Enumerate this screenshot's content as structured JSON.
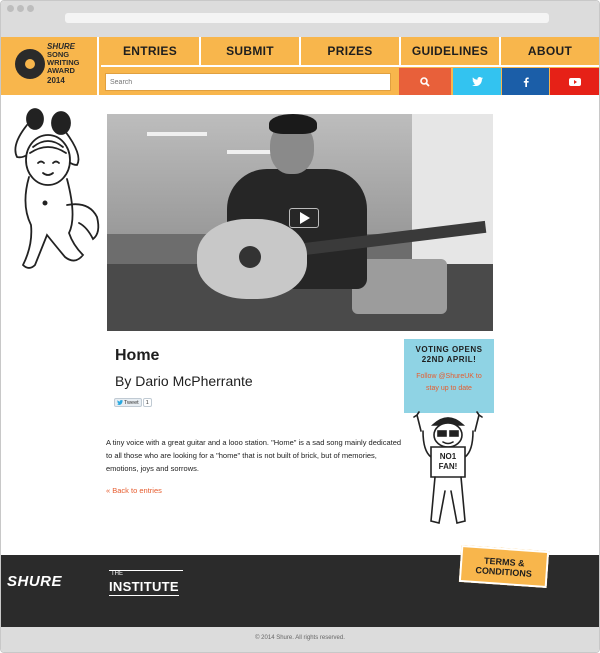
{
  "brand": {
    "brand_name": "SHURE",
    "line1": "SONG",
    "line2": "WRITING",
    "line3": "AWARD",
    "year": "2014"
  },
  "nav": {
    "items": [
      {
        "label": "ENTRIES"
      },
      {
        "label": "SUBMIT"
      },
      {
        "label": "PRIZES"
      },
      {
        "label": "GUIDELINES"
      },
      {
        "label": "ABOUT"
      }
    ]
  },
  "search": {
    "placeholder": "Search"
  },
  "icons": {
    "search": "magnifier-icon",
    "twitter": "twitter-bird-icon",
    "facebook": "facebook-f-icon",
    "youtube": "youtube-play-icon"
  },
  "colors": {
    "accent": "#f8b64c",
    "search_btn": "#e8603a",
    "twitter": "#33c3f0",
    "facebook": "#1b5ea8",
    "youtube": "#e62117",
    "vote_box": "#8fd3e4",
    "link": "#e65c2e"
  },
  "video": {
    "play_icon": "play-icon"
  },
  "entry": {
    "title": "Home",
    "author": "By Dario McPherrante",
    "tweet_label": "Tweet",
    "tweet_count": "1",
    "description": "A tiny voice with a great guitar and a looo station. \"Home\" is a sad song mainly dedicated to all those who are looking for a \"home\" that is not built of brick, but of memories, emotions, joys and sorrows.",
    "back_link": "« Back to entries"
  },
  "vote": {
    "line1": "VOTING OPENS",
    "line2": "22ND APRIL!",
    "follow1": "Follow @ShureUK to",
    "follow2": "stay up to date"
  },
  "mascot": {
    "sign_line1": "NO1",
    "sign_line2": "FAN!"
  },
  "footer": {
    "shure_logo": "SHURE",
    "institute_the": "THE",
    "institute": "INSTITUTE",
    "terms_line1": "TERMS &",
    "terms_line2": "CONDITIONS",
    "copyright": "© 2014 Shure. All rights reserved."
  }
}
